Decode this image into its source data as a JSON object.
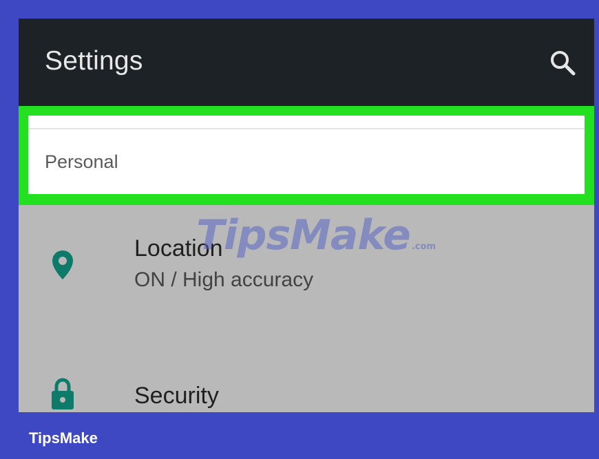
{
  "app_bar": {
    "title": "Settings",
    "search_icon": "search-icon"
  },
  "section": {
    "label": "Personal",
    "highlight_color": "#23e020"
  },
  "items": [
    {
      "icon": "location-pin-icon",
      "title": "Location",
      "subtitle": "ON / High accuracy"
    },
    {
      "icon": "lock-icon",
      "title": "Security"
    }
  ],
  "watermark": {
    "main": "TipsMake",
    "suffix": ".com"
  },
  "footer": {
    "brand": "TipsMake"
  },
  "colors": {
    "background": "#3d48c2",
    "app_bar": "#1c2225",
    "icon_accent": "#0e7a6a",
    "list_background": "#b9b9b9"
  }
}
